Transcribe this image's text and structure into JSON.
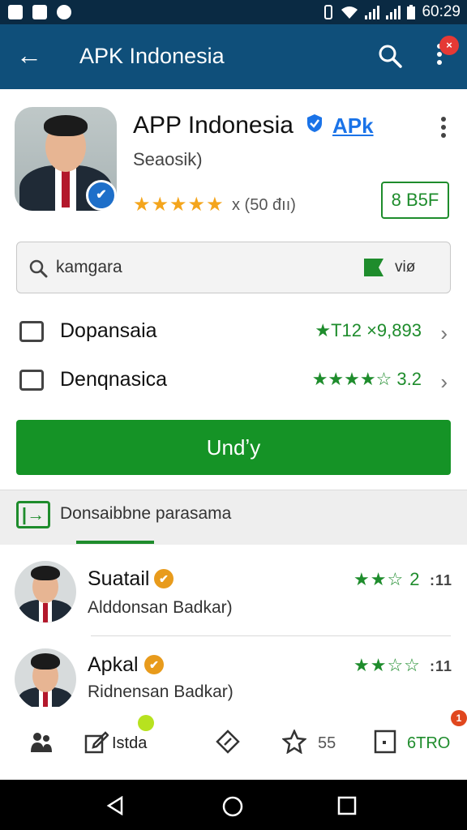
{
  "status_bar": {
    "time": "60:29",
    "icons": [
      "notification-icon",
      "image-icon",
      "sync-icon",
      "vibrate-icon",
      "wifi-icon",
      "signal-icon",
      "battery-icon"
    ]
  },
  "app_bar": {
    "title": "APK Indonesia",
    "notification_count": "×"
  },
  "app": {
    "name": "APP Indonesia",
    "link": "APk",
    "developer": "Seaosik)",
    "stars": "★★★★★",
    "rating_count": "x (50 đıı)",
    "size_button": "8 B5F"
  },
  "search": {
    "value": "kamgara",
    "side_label": "viø"
  },
  "info_rows": [
    {
      "label": "Dopansaia",
      "value": "★T12 ×9,893"
    },
    {
      "label": "Denqnasica",
      "value": "★★★★☆ 3.2"
    }
  ],
  "cta_label": "Undʼу",
  "section": {
    "icon_label": "|→",
    "title": "Donsaibbne parasama"
  },
  "reviews": [
    {
      "name": "Suatail",
      "subtitle": "Alddonsan Badkar)",
      "stars": "★★☆ 2",
      "more": ":11"
    },
    {
      "name": "Apkal",
      "subtitle": "Ridnensan Badkar)",
      "stars": "★★☆☆",
      "more": ":11"
    }
  ],
  "toolbar": {
    "item2_label": "Istda",
    "item4_value": "55",
    "item5_label": "6TRO",
    "badge_text": "1"
  },
  "colors": {
    "app_bar": "#0f4f7a",
    "status_bar": "#0a2a43",
    "accent_green": "#159326",
    "star_gold": "#f4a51c",
    "link_blue": "#1a73e8"
  }
}
